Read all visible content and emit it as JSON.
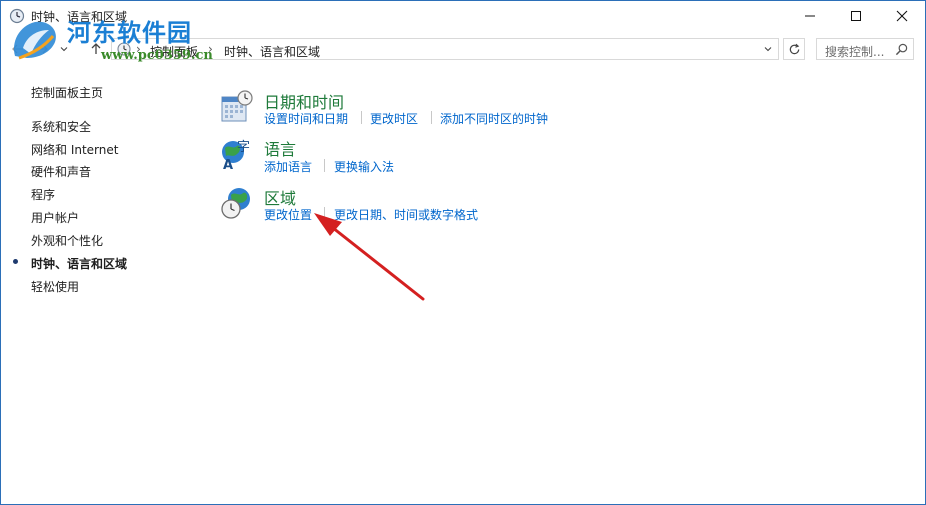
{
  "window": {
    "title": "时钟、语言和区域"
  },
  "watermark": {
    "name": "河东软件园",
    "url": "www.pc0359.cn"
  },
  "address": {
    "crumbs": [
      "控制面板",
      "时钟、语言和区域"
    ]
  },
  "search": {
    "placeholder": "搜索控制..."
  },
  "sidebar": {
    "items": [
      {
        "label": "控制面板主页"
      },
      {
        "label": "系统和安全"
      },
      {
        "label": "网络和 Internet"
      },
      {
        "label": "硬件和声音"
      },
      {
        "label": "程序"
      },
      {
        "label": "用户帐户"
      },
      {
        "label": "外观和个性化"
      },
      {
        "label": "时钟、语言和区域"
      },
      {
        "label": "轻松使用"
      }
    ]
  },
  "categories": [
    {
      "title": "日期和时间",
      "icon": "calendar-clock-icon",
      "links": [
        "设置时间和日期",
        "更改时区",
        "添加不同时区的时钟"
      ]
    },
    {
      "title": "语言",
      "icon": "language-globe-icon",
      "links": [
        "添加语言",
        "更换输入法"
      ]
    },
    {
      "title": "区域",
      "icon": "region-globe-clock-icon",
      "links": [
        "更改位置",
        "更改日期、时间或数字格式"
      ]
    }
  ],
  "colors": {
    "category_title": "#1e7a3a",
    "link": "#0066cc",
    "annotation_arrow": "#d42020"
  }
}
